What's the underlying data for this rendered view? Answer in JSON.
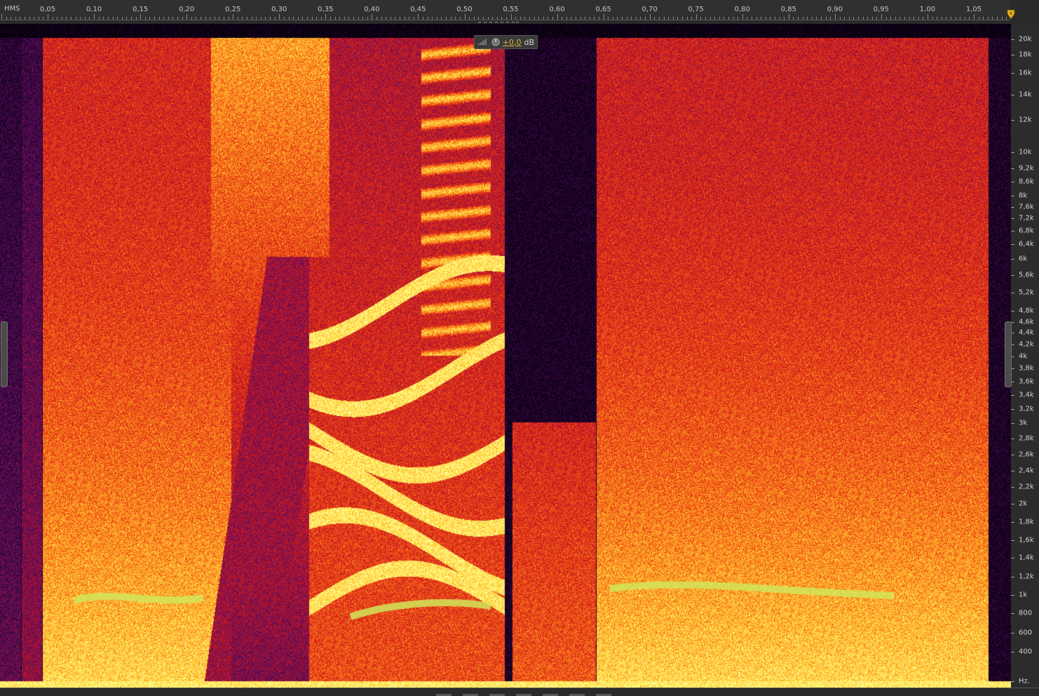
{
  "ruler": {
    "label": "HMS",
    "time_labels": [
      "0,05",
      "0,10",
      "0,15",
      "0,20",
      "0,25",
      "0,30",
      "0,35",
      "0,40",
      "0,45",
      "0,50",
      "0,55",
      "0,60",
      "0,65",
      "0,70",
      "0,75",
      "0,80",
      "0,85",
      "0,90",
      "0,95",
      "1,00",
      "1,05"
    ]
  },
  "level_hud": {
    "value": "+0,0",
    "unit": "dB",
    "icons": [
      "level-meter-icon",
      "gain-knob-icon"
    ]
  },
  "frequency_axis": {
    "labels": [
      "20k",
      "18k",
      "16k",
      "14k",
      "12k",
      "10k",
      "9,2k",
      "8,6k",
      "8k",
      "7,6k",
      "7,2k",
      "6,8k",
      "6,4k",
      "6k",
      "5,6k",
      "5,2k",
      "4,8k",
      "4,6k",
      "4,4k",
      "4,2k",
      "4k",
      "3,8k",
      "3,6k",
      "3,4k",
      "3,2k",
      "3k",
      "2,8k",
      "2,6k",
      "2,4k",
      "2,2k",
      "2k",
      "1,8k",
      "1,6k",
      "1,4k",
      "1,2k",
      "1k",
      "800",
      "600",
      "400",
      "Hz."
    ]
  },
  "colors": {
    "background": "#2b2b2b",
    "spectrogram_low": "#100010",
    "spectrogram_mid": "#d01a10",
    "spectrogram_high": "#fff060",
    "playhead": "#e8b020",
    "hud_value": "#e0b23a"
  },
  "icons": {
    "playhead": "playhead-marker-icon",
    "grip": "ruler-grip-icon"
  }
}
